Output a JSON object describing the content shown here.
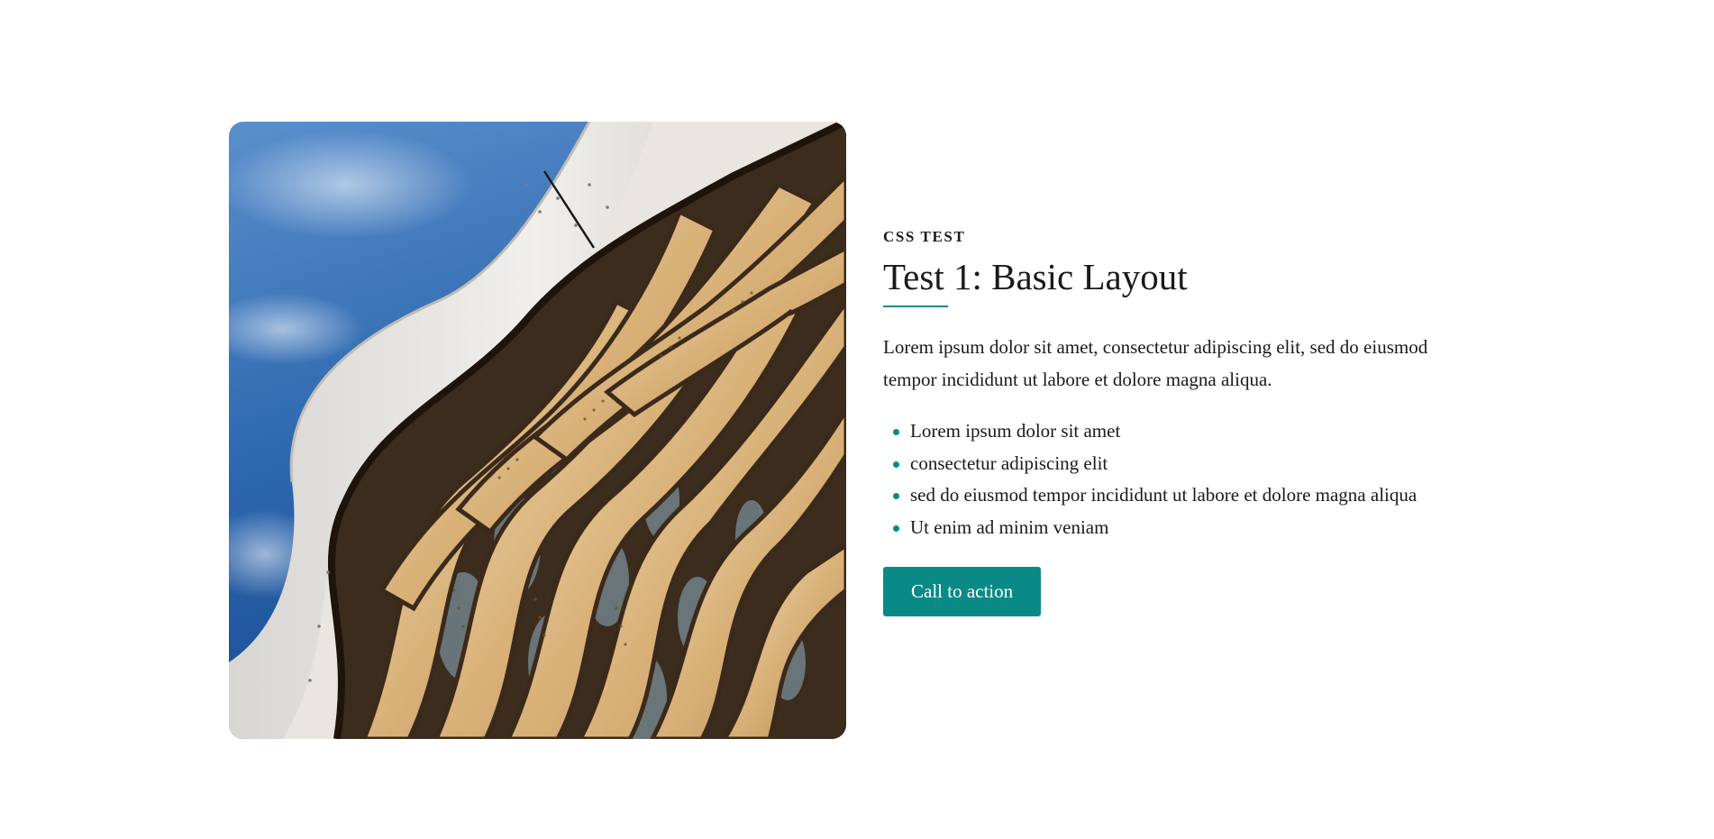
{
  "hero": {
    "image_alt": "Curved wooden architectural facade against a blue sky",
    "eyebrow": "CSS TEST",
    "title": "Test 1: Basic Layout",
    "lead": "Lorem ipsum dolor sit amet, consectetur adipiscing elit, sed do eiusmod tempor incididunt ut labore et dolore magna aliqua.",
    "bullets": [
      "Lorem ipsum dolor sit amet",
      "consectetur adipiscing elit",
      "sed do eiusmod tempor incididunt ut labore et dolore magna aliqua",
      "Ut enim ad minim veniam"
    ],
    "cta_label": "Call to action"
  },
  "colors": {
    "accent": "#0a8a87",
    "text": "#1a1a1a",
    "background": "#ffffff"
  }
}
